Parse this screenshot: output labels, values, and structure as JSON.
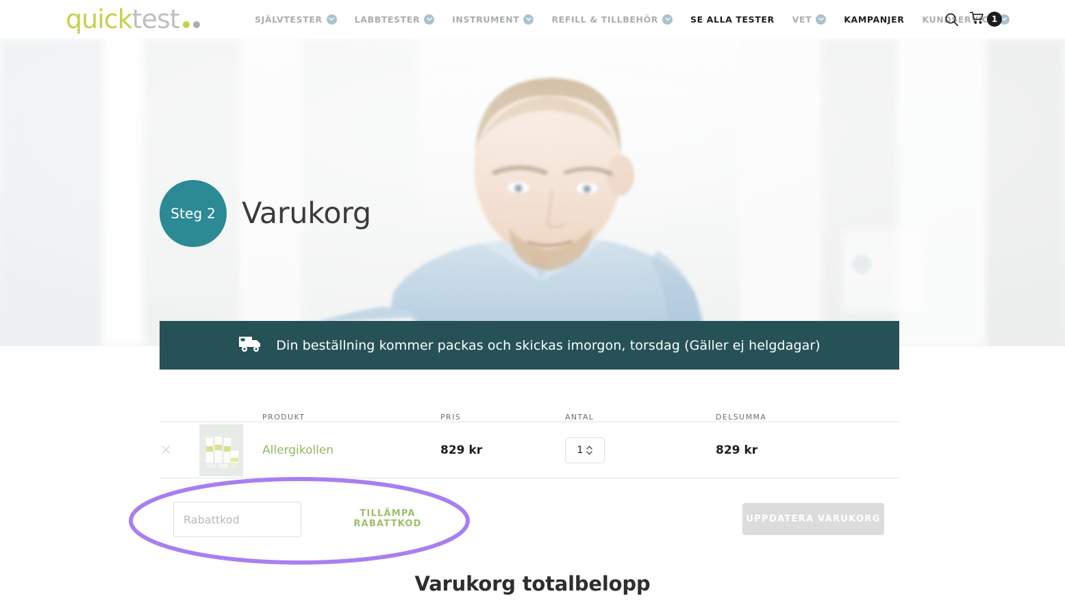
{
  "header": {
    "logo": {
      "part1": "quick",
      "part2": "test",
      "dot1": "green-dot-icon",
      "dot2": "gray-dot-icon"
    },
    "nav": [
      {
        "label": "SJÄLVTESTER",
        "has_caret": true,
        "active": false
      },
      {
        "label": "LABBTESTER",
        "has_caret": true,
        "active": false
      },
      {
        "label": "INSTRUMENT",
        "has_caret": true,
        "active": false
      },
      {
        "label": "REFILL & TILLBEHÖR",
        "has_caret": true,
        "active": false
      },
      {
        "label": "SE ALLA TESTER",
        "has_caret": false,
        "active": true
      },
      {
        "label": "VET",
        "has_caret": true,
        "active": false
      },
      {
        "label": "KAMPANJER",
        "has_caret": false,
        "active": true
      },
      {
        "label": "KUNDSERVICE",
        "has_caret": true,
        "active": false
      }
    ],
    "search_icon": "search-icon",
    "cart_icon": "cart-icon",
    "cart_count": "1"
  },
  "hero": {
    "step_badge": "Steg 2",
    "page_title": "Varukorg"
  },
  "shipping_banner": {
    "icon": "truck-icon",
    "text": "Din beställning kommer packas och skickas imorgon, torsdag (Gäller ej helgdagar)"
  },
  "cart": {
    "columns": {
      "remove": "",
      "thumb": "",
      "product": "PRODUKT",
      "price": "PRIS",
      "quantity": "ANTAL",
      "subtotal": "DELSUMMA"
    },
    "rows": [
      {
        "remove_icon": "close-icon",
        "thumbnail": "product-thumbnail",
        "name": "Allergikollen",
        "price": "829 kr",
        "quantity": "1",
        "subtotal": "829 kr"
      }
    ]
  },
  "coupon": {
    "placeholder": "Rabattkod",
    "value": "",
    "apply_line1": "TILLÄMPA",
    "apply_line2": "RABATTKOD"
  },
  "update_cart_label": "UPPDATERA VARUKORG",
  "totals": {
    "title": "Varukorg totalbelopp"
  },
  "colors": {
    "brand_green": "#c2d24b",
    "link_green": "#8fba62",
    "apply_green": "#9bbf6a",
    "teal_badge": "#2b8a94",
    "banner_teal": "#265257",
    "caret_blue": "#a9c4c8",
    "annotation_purple": "#a87ff0"
  }
}
